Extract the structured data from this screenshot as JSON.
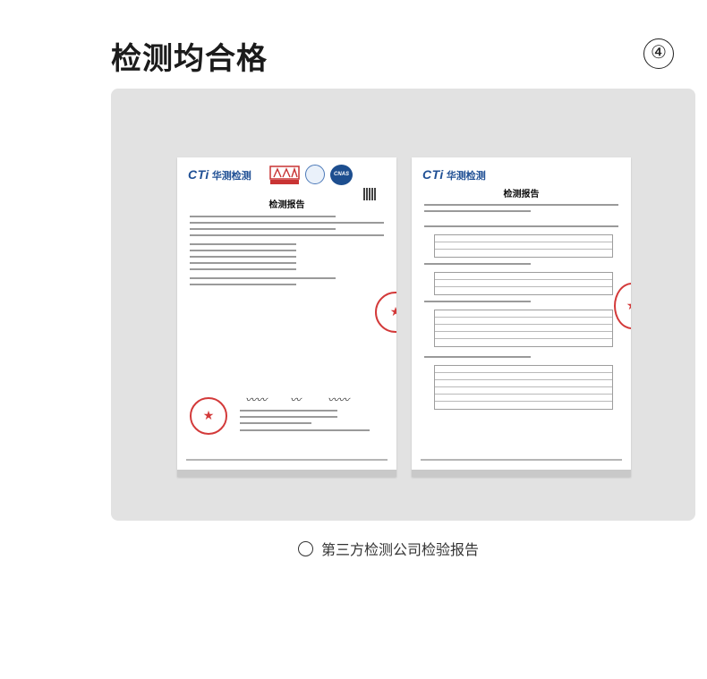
{
  "header": {
    "title": "检测均合格",
    "step_badge": "④"
  },
  "documents": [
    {
      "logo_latin": "CTi",
      "logo_cn": "华测检测",
      "title": "检测报告"
    },
    {
      "logo_latin": "CTi",
      "logo_cn": "华测检测",
      "title": "检测报告"
    }
  ],
  "caption": {
    "text": "第三方检测公司检验报告"
  },
  "colors": {
    "panel_background": "#e2e2e2",
    "logo_blue": "#1f4f94",
    "stamp_red": "#d33a3a"
  }
}
